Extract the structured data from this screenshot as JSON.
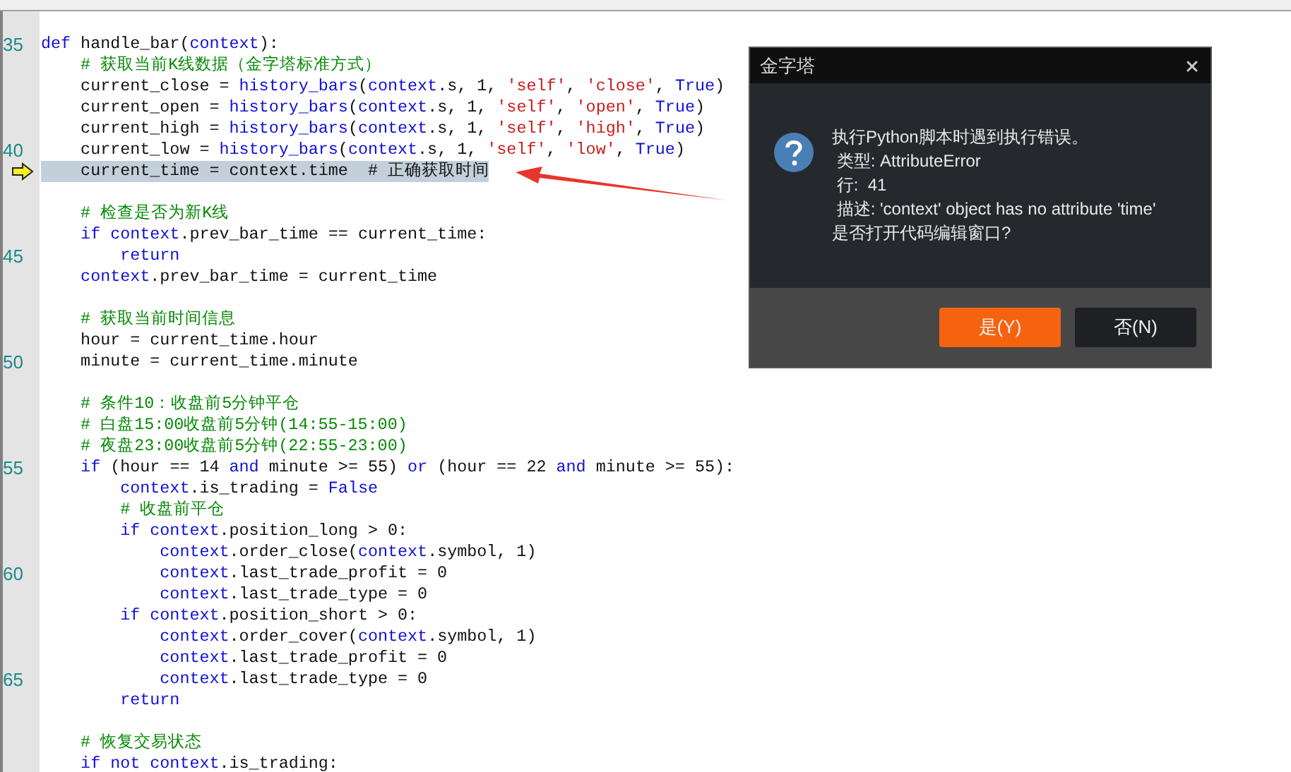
{
  "editor": {
    "lines": [
      {
        "number": "35",
        "current": false,
        "tokens": [
          {
            "kind": "keyword",
            "text": "def"
          },
          {
            "kind": "plain",
            "text": " handle_bar("
          },
          {
            "kind": "keyword",
            "text": "context"
          },
          {
            "kind": "plain",
            "text": "):"
          }
        ]
      },
      {
        "current": false,
        "tokens": [
          {
            "kind": "comment",
            "text": "    # 获取当前K线数据（金字塔标准方式）"
          }
        ]
      },
      {
        "current": false,
        "tokens": [
          {
            "kind": "plain",
            "text": "    current_close = "
          },
          {
            "kind": "keyword",
            "text": "history_bars"
          },
          {
            "kind": "plain",
            "text": "("
          },
          {
            "kind": "keyword",
            "text": "context"
          },
          {
            "kind": "plain",
            "text": ".s, 1, "
          },
          {
            "kind": "string",
            "text": "'self'"
          },
          {
            "kind": "plain",
            "text": ", "
          },
          {
            "kind": "string",
            "text": "'close'"
          },
          {
            "kind": "plain",
            "text": ", "
          },
          {
            "kind": "keyword",
            "text": "True"
          },
          {
            "kind": "plain",
            "text": ")"
          }
        ]
      },
      {
        "current": false,
        "tokens": [
          {
            "kind": "plain",
            "text": "    current_open = "
          },
          {
            "kind": "keyword",
            "text": "history_bars"
          },
          {
            "kind": "plain",
            "text": "("
          },
          {
            "kind": "keyword",
            "text": "context"
          },
          {
            "kind": "plain",
            "text": ".s, 1, "
          },
          {
            "kind": "string",
            "text": "'self'"
          },
          {
            "kind": "plain",
            "text": ", "
          },
          {
            "kind": "string",
            "text": "'open'"
          },
          {
            "kind": "plain",
            "text": ", "
          },
          {
            "kind": "keyword",
            "text": "True"
          },
          {
            "kind": "plain",
            "text": ")"
          }
        ]
      },
      {
        "current": false,
        "tokens": [
          {
            "kind": "plain",
            "text": "    current_high = "
          },
          {
            "kind": "keyword",
            "text": "history_bars"
          },
          {
            "kind": "plain",
            "text": "("
          },
          {
            "kind": "keyword",
            "text": "context"
          },
          {
            "kind": "plain",
            "text": ".s, 1, "
          },
          {
            "kind": "string",
            "text": "'self'"
          },
          {
            "kind": "plain",
            "text": ", "
          },
          {
            "kind": "string",
            "text": "'high'"
          },
          {
            "kind": "plain",
            "text": ", "
          },
          {
            "kind": "keyword",
            "text": "True"
          },
          {
            "kind": "plain",
            "text": ")"
          }
        ]
      },
      {
        "number": "40",
        "current": false,
        "tokens": [
          {
            "kind": "plain",
            "text": "    current_low = "
          },
          {
            "kind": "keyword",
            "text": "history_bars"
          },
          {
            "kind": "plain",
            "text": "("
          },
          {
            "kind": "keyword",
            "text": "context"
          },
          {
            "kind": "plain",
            "text": ".s, 1, "
          },
          {
            "kind": "string",
            "text": "'self'"
          },
          {
            "kind": "plain",
            "text": ", "
          },
          {
            "kind": "string",
            "text": "'low'"
          },
          {
            "kind": "plain",
            "text": ", "
          },
          {
            "kind": "keyword",
            "text": "True"
          },
          {
            "kind": "plain",
            "text": ")"
          }
        ]
      },
      {
        "current": true,
        "tokens": [
          {
            "kind": "plain",
            "text": "    current_time = context.time  "
          },
          {
            "kind": "comment",
            "text": "# 正确获取时间"
          }
        ]
      },
      {
        "current": false
      },
      {
        "current": false,
        "tokens": [
          {
            "kind": "comment",
            "text": "    # 检查是否为新K线"
          }
        ]
      },
      {
        "current": false,
        "tokens": [
          {
            "kind": "keyword",
            "text": "    if context"
          },
          {
            "kind": "plain",
            "text": ".prev_bar_time == current_time:"
          }
        ]
      },
      {
        "number": "45",
        "current": false,
        "tokens": [
          {
            "kind": "keyword",
            "text": "        return"
          }
        ]
      },
      {
        "current": false,
        "tokens": [
          {
            "kind": "keyword",
            "text": "    context"
          },
          {
            "kind": "plain",
            "text": ".prev_bar_time = current_time"
          }
        ]
      },
      {
        "current": false
      },
      {
        "current": false,
        "tokens": [
          {
            "kind": "comment",
            "text": "    # 获取当前时间信息"
          }
        ]
      },
      {
        "current": false,
        "tokens": [
          {
            "kind": "plain",
            "text": "    hour = current_time.hour"
          }
        ]
      },
      {
        "number": "50",
        "current": false,
        "tokens": [
          {
            "kind": "plain",
            "text": "    minute = current_time.minute"
          }
        ]
      },
      {
        "current": false
      },
      {
        "current": false,
        "tokens": [
          {
            "kind": "comment",
            "text": "    # 条件10：收盘前5分钟平仓"
          }
        ]
      },
      {
        "current": false,
        "tokens": [
          {
            "kind": "comment",
            "text": "    # 白盘15:00收盘前5分钟(14:55-15:00)"
          }
        ]
      },
      {
        "current": false,
        "tokens": [
          {
            "kind": "comment",
            "text": "    # 夜盘23:00收盘前5分钟(22:55-23:00)"
          }
        ]
      },
      {
        "number": "55",
        "current": false,
        "tokens": [
          {
            "kind": "keyword",
            "text": "    if"
          },
          {
            "kind": "plain",
            "text": " (hour == 14 "
          },
          {
            "kind": "keyword",
            "text": "and"
          },
          {
            "kind": "plain",
            "text": " minute >= 55) "
          },
          {
            "kind": "keyword",
            "text": "or"
          },
          {
            "kind": "plain",
            "text": " (hour == 22 "
          },
          {
            "kind": "keyword",
            "text": "and"
          },
          {
            "kind": "plain",
            "text": " minute >= 55):"
          }
        ]
      },
      {
        "current": false,
        "tokens": [
          {
            "kind": "keyword",
            "text": "        context"
          },
          {
            "kind": "plain",
            "text": ".is_trading = "
          },
          {
            "kind": "keyword",
            "text": "False"
          }
        ]
      },
      {
        "current": false,
        "tokens": [
          {
            "kind": "comment",
            "text": "        # 收盘前平仓"
          }
        ]
      },
      {
        "current": false,
        "tokens": [
          {
            "kind": "keyword",
            "text": "        if context"
          },
          {
            "kind": "plain",
            "text": ".position_long > 0:"
          }
        ]
      },
      {
        "current": false,
        "tokens": [
          {
            "kind": "keyword",
            "text": "            context"
          },
          {
            "kind": "plain",
            "text": ".order_close("
          },
          {
            "kind": "keyword",
            "text": "context"
          },
          {
            "kind": "plain",
            "text": ".symbol, 1)"
          }
        ]
      },
      {
        "number": "60",
        "current": false,
        "tokens": [
          {
            "kind": "keyword",
            "text": "            context"
          },
          {
            "kind": "plain",
            "text": ".last_trade_profit = 0"
          }
        ]
      },
      {
        "current": false,
        "tokens": [
          {
            "kind": "keyword",
            "text": "            context"
          },
          {
            "kind": "plain",
            "text": ".last_trade_type = 0"
          }
        ]
      },
      {
        "current": false,
        "tokens": [
          {
            "kind": "keyword",
            "text": "        if context"
          },
          {
            "kind": "plain",
            "text": ".position_short > 0:"
          }
        ]
      },
      {
        "current": false,
        "tokens": [
          {
            "kind": "keyword",
            "text": "            context"
          },
          {
            "kind": "plain",
            "text": ".order_cover("
          },
          {
            "kind": "keyword",
            "text": "context"
          },
          {
            "kind": "plain",
            "text": ".symbol, 1)"
          }
        ]
      },
      {
        "current": false,
        "tokens": [
          {
            "kind": "keyword",
            "text": "            context"
          },
          {
            "kind": "plain",
            "text": ".last_trade_profit = 0"
          }
        ]
      },
      {
        "number": "65",
        "current": false,
        "tokens": [
          {
            "kind": "keyword",
            "text": "            context"
          },
          {
            "kind": "plain",
            "text": ".last_trade_type = 0"
          }
        ]
      },
      {
        "current": false,
        "tokens": [
          {
            "kind": "keyword",
            "text": "        return"
          }
        ]
      },
      {
        "current": false
      },
      {
        "current": false,
        "tokens": [
          {
            "kind": "comment",
            "text": "    # 恢复交易状态"
          }
        ]
      },
      {
        "current": false,
        "tokens": [
          {
            "kind": "keyword",
            "text": "    if not context"
          },
          {
            "kind": "plain",
            "text": ".is_trading:"
          }
        ]
      }
    ]
  },
  "dialog": {
    "title": "金字塔",
    "message": [
      "执行Python脚本时遇到执行错误。",
      " 类型: AttributeError",
      " 行:  41",
      " 描述: 'context' object has no attribute 'time'",
      "是否打开代码编辑窗口?"
    ],
    "buttons": [
      {
        "label": "是(Y)",
        "selected": true
      },
      {
        "label": "否(N)",
        "selected": false
      }
    ]
  }
}
